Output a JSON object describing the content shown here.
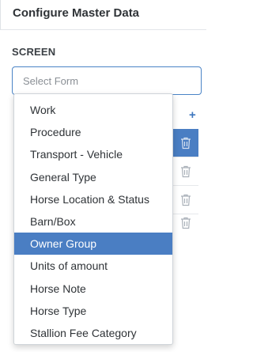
{
  "panel": {
    "title": "Configure Master Data"
  },
  "section": {
    "label": "SCREEN"
  },
  "select": {
    "placeholder": "Select Form",
    "value": ""
  },
  "dropdown": {
    "items": [
      "Work",
      "Procedure",
      "Transport - Vehicle",
      "General Type",
      "Horse Location & Status",
      "Barn/Box",
      "Owner Group",
      "Units of amount",
      "Horse Note",
      "Horse Type",
      "Stallion Fee Category"
    ],
    "highlighted": "Owner Group"
  },
  "colors": {
    "accent": "#4a7ec3",
    "border_focus": "#4a84c6"
  },
  "icons": {
    "add": "plus-icon",
    "delete": "trash-icon"
  }
}
